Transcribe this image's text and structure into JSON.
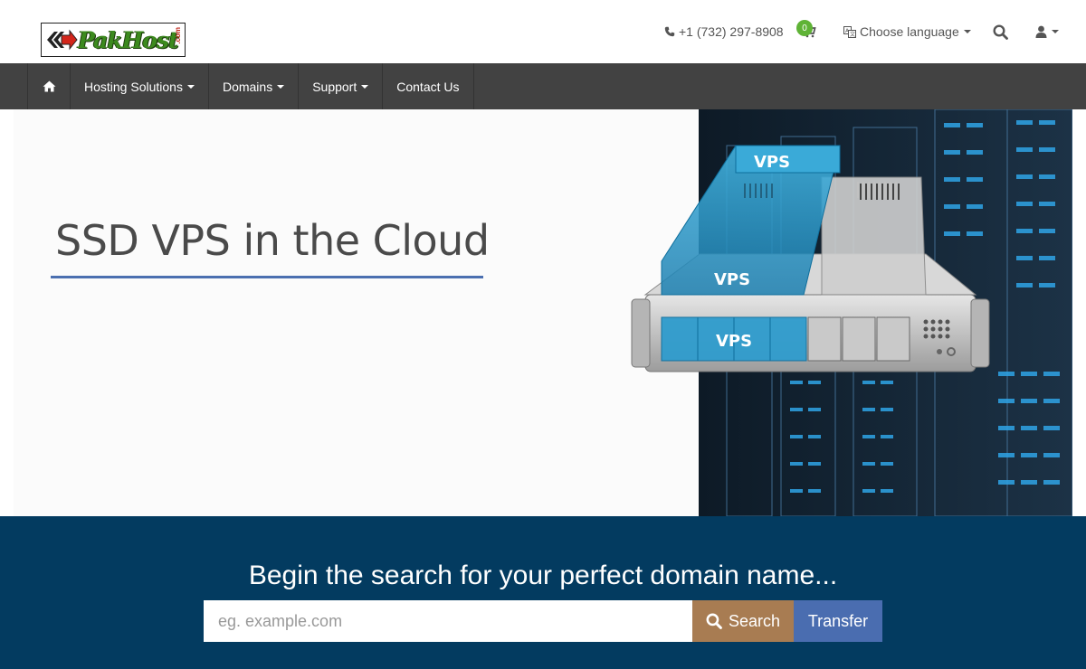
{
  "header": {
    "logo_text": "PakHost",
    "logo_suffix": ".com",
    "phone": "+1 (732) 297-8908",
    "cart_count": "0",
    "language_label": "Choose language"
  },
  "nav": {
    "items": [
      {
        "label": "Hosting Solutions",
        "dropdown": true
      },
      {
        "label": "Domains",
        "dropdown": true
      },
      {
        "label": "Support",
        "dropdown": true
      },
      {
        "label": "Contact Us",
        "dropdown": false
      }
    ]
  },
  "hero": {
    "title": "SSD VPS in the Cloud",
    "art_labels": [
      "VPS",
      "VPS",
      "VPS"
    ]
  },
  "domain_search": {
    "heading": "Begin the search for your perfect domain name...",
    "placeholder": "eg. example.com",
    "search_label": "Search",
    "transfer_label": "Transfer"
  },
  "colors": {
    "nav_bg": "#424242",
    "domain_bg": "#033b60",
    "search_btn": "#a87c52",
    "transfer_btn": "#4a6db0",
    "underline": "#4b6fb0",
    "badge": "#5fb336"
  },
  "icons": [
    "phone-icon",
    "cart-icon",
    "language-icon",
    "search-icon",
    "user-icon",
    "home-icon"
  ]
}
